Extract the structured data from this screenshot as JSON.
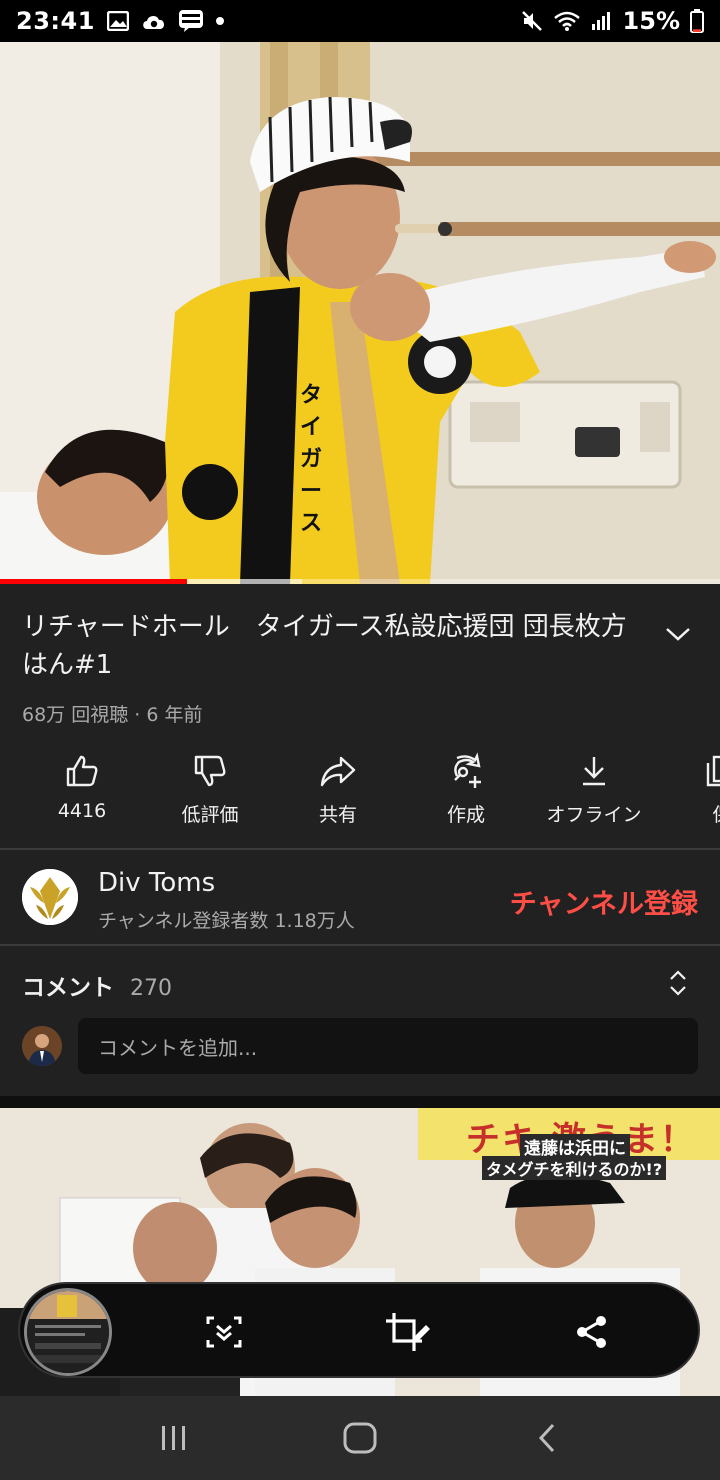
{
  "status_bar": {
    "time": "23:41",
    "battery_percent": "15%",
    "battery_level": 0.15,
    "icons_left": [
      "gallery-icon",
      "cloud-sync-icon",
      "line-manga-icon",
      "dot-icon"
    ],
    "icons_right": [
      "mute-icon",
      "wifi-icon",
      "signal-icon",
      "battery-icon"
    ]
  },
  "player": {
    "progress_played": 0.26,
    "progress_buffered": 0.42,
    "accent_color": "#ff0000"
  },
  "video": {
    "title": "リチャードホール　タイガース私設応援団 団長枚方はん#1",
    "meta": "68万 回視聴 · 6 年前"
  },
  "actions": [
    {
      "name": "like",
      "icon": "thumbs-up-icon",
      "label": "4416"
    },
    {
      "name": "dislike",
      "icon": "thumbs-down-icon",
      "label": "低評価"
    },
    {
      "name": "share",
      "icon": "share-arrow-icon",
      "label": "共有"
    },
    {
      "name": "create",
      "icon": "create-remix-icon",
      "label": "作成"
    },
    {
      "name": "offline",
      "icon": "download-icon",
      "label": "オフライン"
    },
    {
      "name": "save",
      "icon": "save-playlist-icon",
      "label": "保"
    }
  ],
  "channel": {
    "name": "Div Toms",
    "subscribers": "チャンネル登録者数 1.18万人",
    "subscribe_label": "チャンネル登録",
    "subscribe_color": "#ff4e45"
  },
  "comments": {
    "label": "コメント",
    "count": "270",
    "placeholder": "コメントを追加..."
  },
  "next_video": {
    "caption_top": "チキ 激うま！",
    "caption_line1": "遠藤は浜田に",
    "caption_line2": "タメグチを利けるのか!?"
  },
  "floating_toolbar": {
    "buttons": [
      "scroll-capture-icon",
      "crop-edit-icon",
      "share-icon"
    ]
  },
  "nav_bar": {
    "buttons": [
      "recent-apps-icon",
      "home-icon",
      "back-icon"
    ]
  }
}
